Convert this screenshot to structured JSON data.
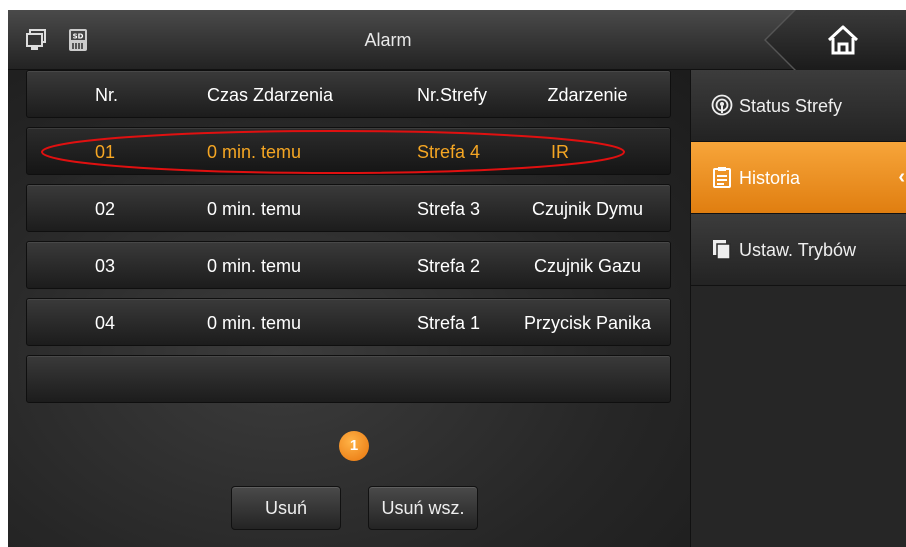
{
  "topbar": {
    "title": "Alarm",
    "icons": [
      "monitor-icon",
      "sd-card-icon",
      "home-icon"
    ],
    "sd_label": "SD"
  },
  "table": {
    "headers": {
      "nr": "Nr.",
      "time": "Czas Zdarzenia",
      "zone": "Nr.Strefy",
      "event": "Zdarzenie"
    },
    "rows": [
      {
        "nr": "01",
        "time": "0 min. temu",
        "zone": "Strefa 4",
        "event": "IR"
      },
      {
        "nr": "02",
        "time": "0 min. temu",
        "zone": "Strefa 3",
        "event": "Czujnik Dymu"
      },
      {
        "nr": "03",
        "time": "0 min. temu",
        "zone": "Strefa 2",
        "event": "Czujnik Gazu"
      },
      {
        "nr": "04",
        "time": "0 min. temu",
        "zone": "Strefa 1",
        "event": "Przycisk Panika"
      }
    ],
    "selected_row": "01"
  },
  "pager": {
    "page": "1"
  },
  "buttons": {
    "delete": "Usuń",
    "delete_all": "Usuń wsz."
  },
  "sidebar": {
    "items": [
      {
        "label": "Status Strefy",
        "icon": "podcast-icon"
      },
      {
        "label": "Historia",
        "icon": "clipboard-icon",
        "active": true
      },
      {
        "label": "Ustaw. Trybów",
        "icon": "copy-icon"
      }
    ]
  },
  "colors": {
    "accent": "#f5a623",
    "active_tab": "#ef9226",
    "highlight_oval": "#e01010"
  }
}
